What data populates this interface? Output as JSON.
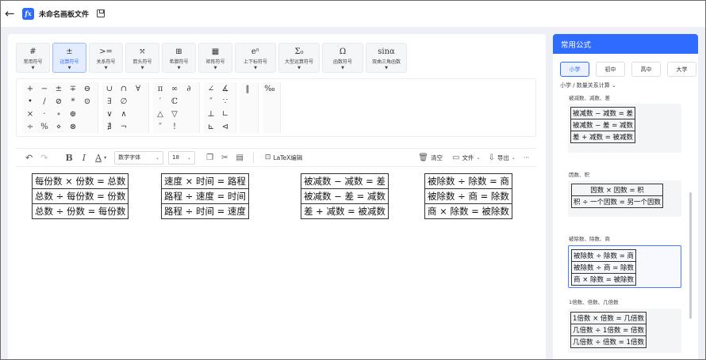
{
  "titlebar": {
    "back_icon": "back-arrow-icon",
    "logo_text": "fx",
    "title": "未命名画板文件",
    "save_icon": "save-icon"
  },
  "symbol_tabs": [
    {
      "glyph": "#",
      "label": "常用符号"
    },
    {
      "glyph": "±",
      "label": "运算符号",
      "active": true
    },
    {
      "glyph": ">=",
      "label": "关系符号"
    },
    {
      "glyph": "⤲",
      "label": "箭头符号"
    },
    {
      "glyph": "⊞",
      "label": "希腊符号"
    },
    {
      "glyph": "▦",
      "label": "矩阵符号"
    },
    {
      "glyph": "eⁿ",
      "label": "上下标符号"
    },
    {
      "glyph": "Σ₀",
      "label": "大型运算符号"
    },
    {
      "glyph": "Ω",
      "label": "函数符号"
    },
    {
      "glyph": "sinα",
      "label": "双曲三角函数"
    }
  ],
  "symbol_groups": [
    {
      "cols": 5,
      "symbols": [
        "+",
        "−",
        "±",
        "∓",
        "⊖",
        "•",
        "/",
        "⊘",
        "*",
        "⊙",
        "×",
        "·",
        "∘",
        "⊕",
        "",
        "÷",
        "%",
        "⋄",
        "⊗",
        ""
      ]
    },
    {
      "cols": 3,
      "symbols": [
        "∪",
        "∩",
        "∀",
        "∃",
        "∅",
        "",
        "∨",
        "∧",
        "",
        "∄",
        "¬",
        ""
      ]
    },
    {
      "cols": 3,
      "symbols": [
        "π",
        "∞",
        "∂",
        "′",
        "ℂ",
        "",
        "△",
        "▽",
        "",
        "″",
        "!",
        ""
      ]
    },
    {
      "cols": 2,
      "symbols": [
        "∠",
        "∡",
        "″",
        "∵",
        "⊥",
        "∟",
        "⊾",
        "⊲"
      ]
    },
    {
      "cols": 1,
      "symbols": [
        "‖",
        "",
        "",
        ""
      ]
    },
    {
      "cols": 1,
      "symbols": [
        "‰",
        "",
        "",
        ""
      ]
    }
  ],
  "toolbar": {
    "undo_icon": "undo-icon",
    "redo_icon": "redo-icon",
    "bold_label": "B",
    "italic_label": "I",
    "color_label": "A",
    "font_value": "数学字体",
    "size_value": "18",
    "latex_label": "LaTeX编辑",
    "clear_label": "清空",
    "file_label": "文件",
    "export_label": "导出",
    "more_label": "···"
  },
  "editor_tables": [
    [
      "每份数 × 份数 = 总数",
      "总数 ÷ 每份数 = 份数",
      "总数 ÷ 份数 = 每份数"
    ],
    [
      "速度 × 时间 = 路程",
      "路程 ÷ 速度 = 时间",
      "路程 ÷ 时间 = 速度"
    ],
    [
      "被减数 − 减数 = 差",
      "被减数 − 差 = 减数",
      "差 + 减数 = 被减数"
    ],
    [
      "被除数 ÷ 除数 = 商",
      "被除数 ÷ 商 = 除数",
      "商 × 除数 = 被除数"
    ]
  ],
  "right_panel": {
    "title": "常用公式",
    "grades": [
      "小学",
      "初中",
      "高中",
      "大学"
    ],
    "active_grade": "小学",
    "breadcrumb": "小学 / 数量关系计算 ⌄",
    "categories": [
      {
        "title": "被减数、减数、差",
        "rows": [
          "被减数 − 减数 = 差",
          "被减数 − 差 = 减数",
          "差 + 减数 = 被减数"
        ]
      },
      {
        "title": "因数、积",
        "rows": [
          "因数 × 因数 = 积",
          "积 ÷ 一个因数 = 另一个因数"
        ]
      },
      {
        "title": "被除数、除数、商",
        "rows": [
          "被除数 ÷ 除数 = 商",
          "被除数 ÷ 商 = 除数",
          "商 × 除数 = 被除数"
        ],
        "selected": true
      },
      {
        "title": "1倍数、倍数、几倍数",
        "rows": [
          "1倍数 × 倍数 = 几倍数",
          "几倍数 ÷ 1倍数 = 倍数",
          "几倍数 ÷ 倍数 = 1倍数"
        ]
      }
    ]
  }
}
